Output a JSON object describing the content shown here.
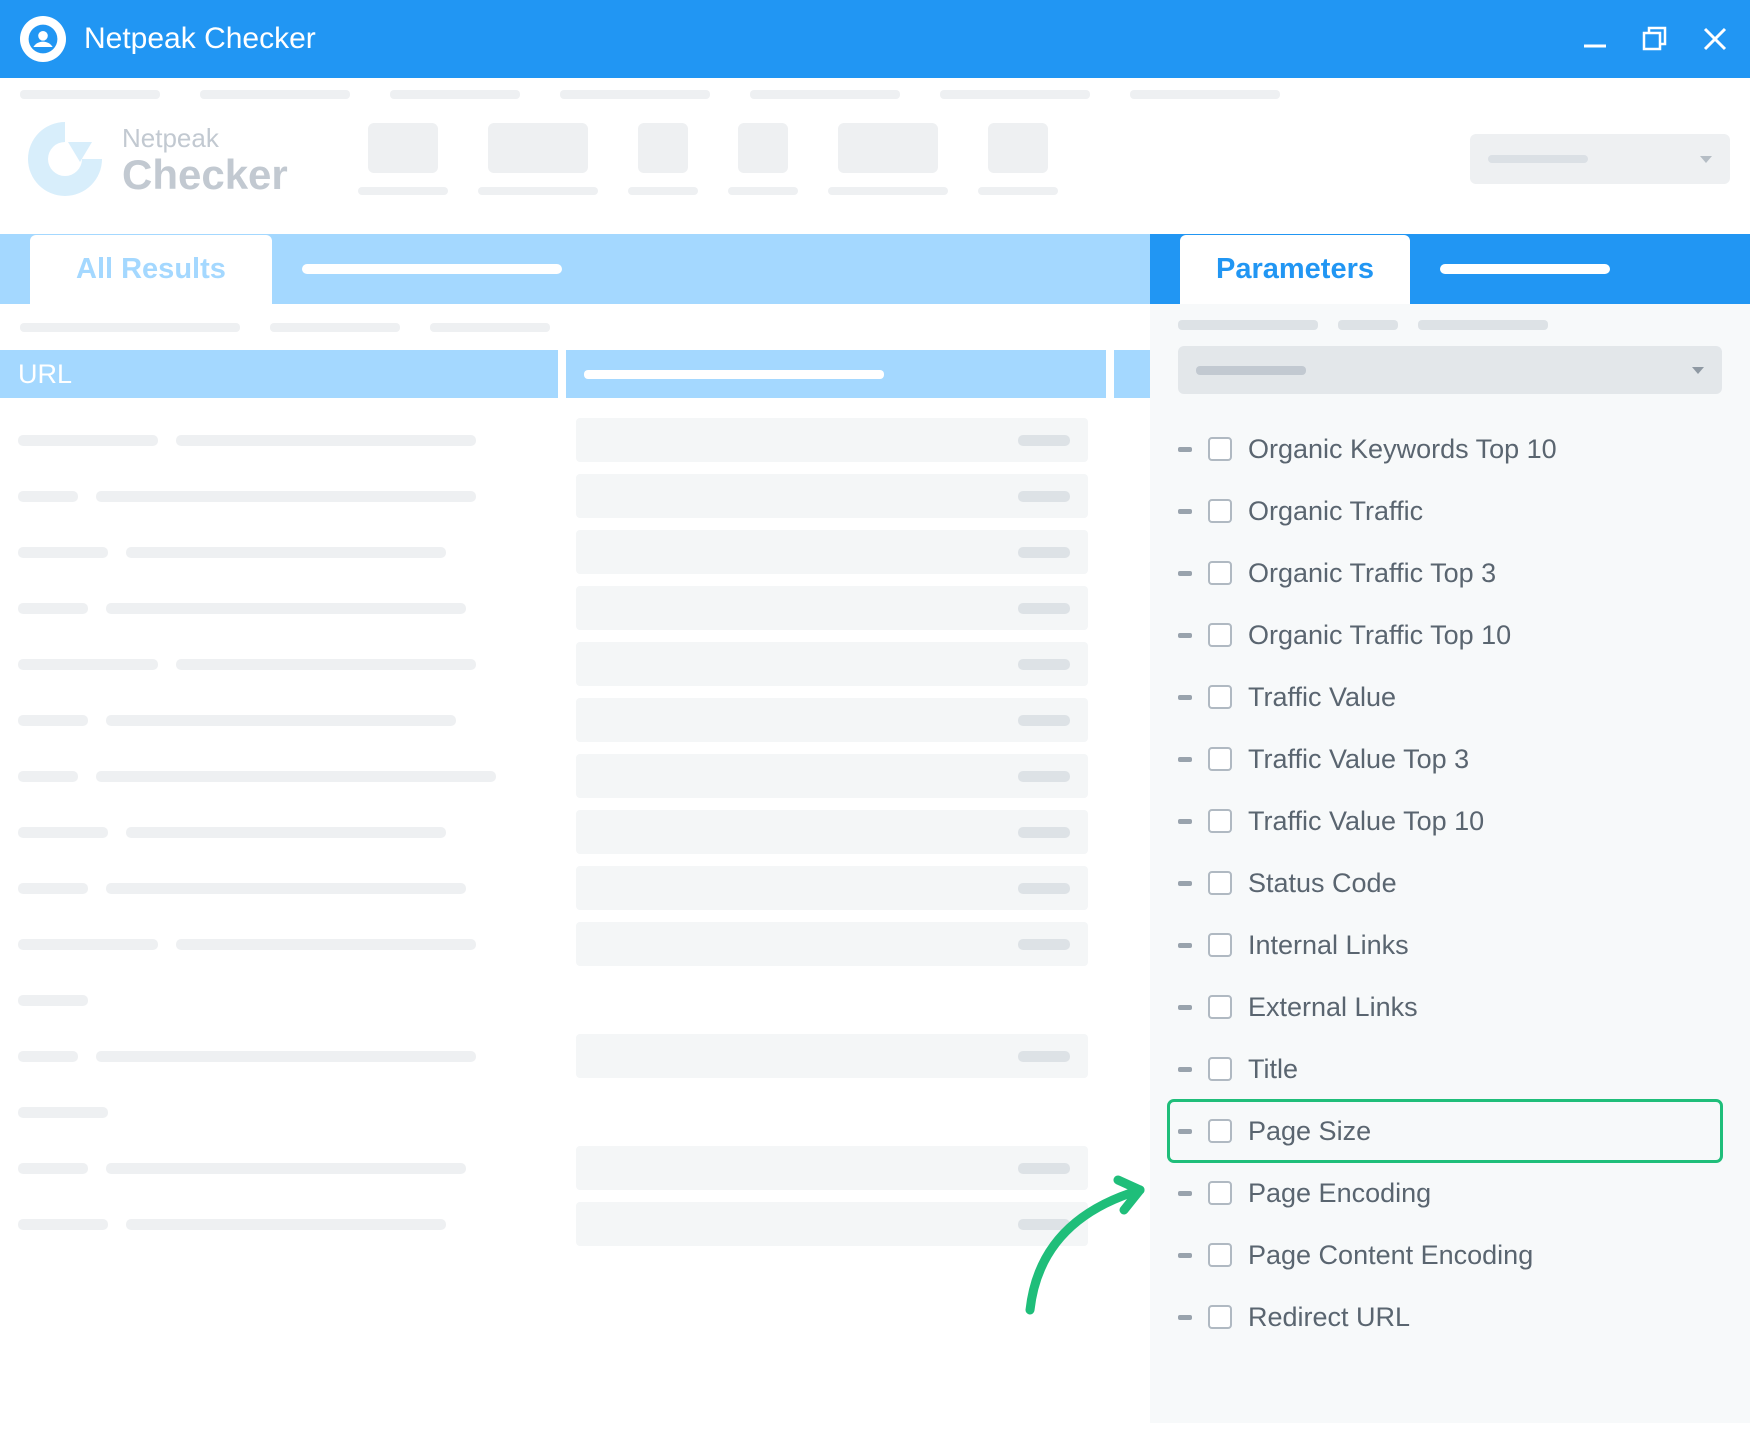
{
  "titlebar": {
    "title": "Netpeak Checker"
  },
  "logo": {
    "sub": "Netpeak",
    "main": "Checker"
  },
  "left_tabs": {
    "active": "All Results"
  },
  "table": {
    "col1": "URL"
  },
  "right_tabs": {
    "active": "Parameters"
  },
  "parameters": [
    {
      "label": "Organic Keywords Top 10",
      "highlight": false
    },
    {
      "label": "Organic Traffic",
      "highlight": false
    },
    {
      "label": "Organic Traffic Top 3",
      "highlight": false
    },
    {
      "label": "Organic Traffic Top 10",
      "highlight": false
    },
    {
      "label": "Traffic Value",
      "highlight": false
    },
    {
      "label": "Traffic Value Top 3",
      "highlight": false
    },
    {
      "label": "Traffic Value Top 10",
      "highlight": false
    },
    {
      "label": "Status Code",
      "highlight": false
    },
    {
      "label": "Internal Links",
      "highlight": false
    },
    {
      "label": "External Links",
      "highlight": false
    },
    {
      "label": "Title",
      "highlight": false
    },
    {
      "label": "Page Size",
      "highlight": true
    },
    {
      "label": "Page Encoding",
      "highlight": false
    },
    {
      "label": "Page Content Encoding",
      "highlight": false
    },
    {
      "label": "Redirect URL",
      "highlight": false
    }
  ],
  "colors": {
    "primary": "#2196F3",
    "lightblue": "#a4d8ff",
    "highlight": "#1fbe7a"
  }
}
